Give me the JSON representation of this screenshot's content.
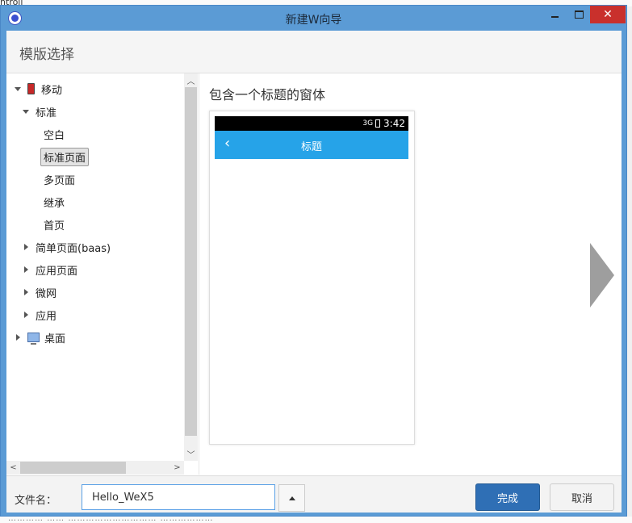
{
  "background_app": {
    "left_text": "ntroll",
    "bottom_text": "………… …… ………………………… ………………"
  },
  "window": {
    "title": "新建W向导",
    "close_glyph": "✕"
  },
  "header": {
    "title": "模版选择"
  },
  "tree": {
    "items": [
      {
        "label": "移动",
        "expanded": true,
        "icon": "phone-icon"
      },
      {
        "label": "标准",
        "expanded": true
      },
      {
        "label": "空白"
      },
      {
        "label": "标准页面",
        "selected": true
      },
      {
        "label": "多页面"
      },
      {
        "label": "继承"
      },
      {
        "label": "首页"
      },
      {
        "label": "简单页面(baas)",
        "expanded": false
      },
      {
        "label": "应用页面",
        "expanded": false
      },
      {
        "label": "微网",
        "expanded": false
      },
      {
        "label": "应用",
        "expanded": false
      },
      {
        "label": "桌面",
        "expanded": false,
        "icon": "desktop-icon"
      }
    ],
    "scroll_up": "︿",
    "scroll_down": "﹀",
    "scroll_left": "<",
    "scroll_right": ">"
  },
  "preview": {
    "title": "包含一个标题的窗体",
    "phone": {
      "time": "3:42",
      "signal": "3G",
      "appbar_title": "标题",
      "back_glyph": "‹"
    }
  },
  "footer": {
    "filename_label": "文件名：",
    "filename_value": "Hello_WeX5",
    "finish_label": "完成",
    "cancel_label": "取消"
  },
  "colors": {
    "accent": "#2f6fb5",
    "titlebar": "#5b9bd5",
    "appbar": "#26a3e8",
    "close": "#c9302c"
  }
}
